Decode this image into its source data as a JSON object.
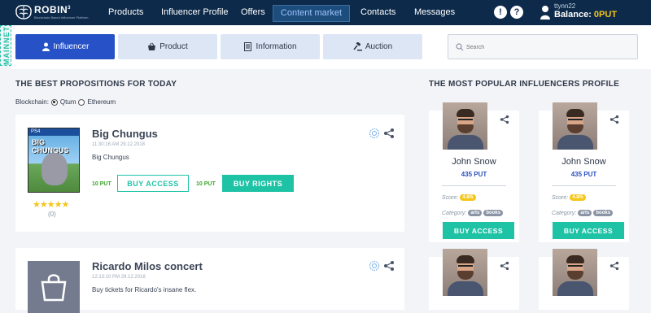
{
  "brand": {
    "name": "ROBIN",
    "sup": "3",
    "tagline": "Blockchain Based Influencer Platform"
  },
  "nav": {
    "items": [
      {
        "label": "Products"
      },
      {
        "label": "Influencer Profile"
      },
      {
        "label": "Offers"
      },
      {
        "label": "Content market"
      },
      {
        "label": "Contacts"
      },
      {
        "label": "Messages"
      }
    ],
    "active": "Content market",
    "alert_icon": "!",
    "help_icon": "?"
  },
  "user": {
    "name": "ttynn22",
    "balance_label": "Balance:",
    "balance_value": "0PUT"
  },
  "network": "MAINNET",
  "tabs": [
    {
      "label": "Influencer",
      "icon": "user-icon"
    },
    {
      "label": "Product",
      "icon": "basket-icon"
    },
    {
      "label": "Information",
      "icon": "document-icon"
    },
    {
      "label": "Auction",
      "icon": "gavel-icon"
    }
  ],
  "search": {
    "placeholder": "Search"
  },
  "propositions": {
    "heading": "THE BEST PROPOSITIONS FOR TODAY",
    "blockchain_label": "Blockchain:",
    "blockchain_options": [
      "Qtum",
      "Ethereum"
    ],
    "blockchain_selected": "Qtum",
    "items": [
      {
        "title": "Big Chungus",
        "date": "11:30:16 AM 29.12.2018",
        "description": "Big Chungus",
        "access_price": "10 PUT",
        "access_label": "BUY ACCESS",
        "rights_price": "10 PUT",
        "rights_label": "BUY RIGHTS",
        "poster_brand": "PS4",
        "poster_title": "BIG CHUNGUS",
        "rating": 5,
        "rating_count": "(0)"
      },
      {
        "title": "Ricardo Milos concert",
        "date": "12:13:10 PM 29.12.2018",
        "description": "Buy tickets for Ricardo's insane flex."
      }
    ]
  },
  "influencers": {
    "heading": "THE MOST POPULAR INFLUENCERS PROFILE",
    "cards": [
      {
        "name": "John Snow",
        "put": "435 PUT",
        "score_label": "Score:",
        "score": "4.8/5",
        "category_label": "Category:",
        "tags": [
          "arts",
          "books"
        ],
        "button": "BUY ACCESS"
      },
      {
        "name": "John Snow",
        "put": "435 PUT",
        "score_label": "Score:",
        "score": "4.8/5",
        "category_label": "Category:",
        "tags": [
          "arts",
          "books"
        ],
        "button": "BUY ACCESS"
      }
    ]
  },
  "colors": {
    "nav_bg": "#0d2a4a",
    "accent": "#1ec3a6",
    "active_tab": "#2651c7",
    "price_green": "#3ba629",
    "put_blue": "#2a52be",
    "badge_yellow": "#f5c518"
  }
}
